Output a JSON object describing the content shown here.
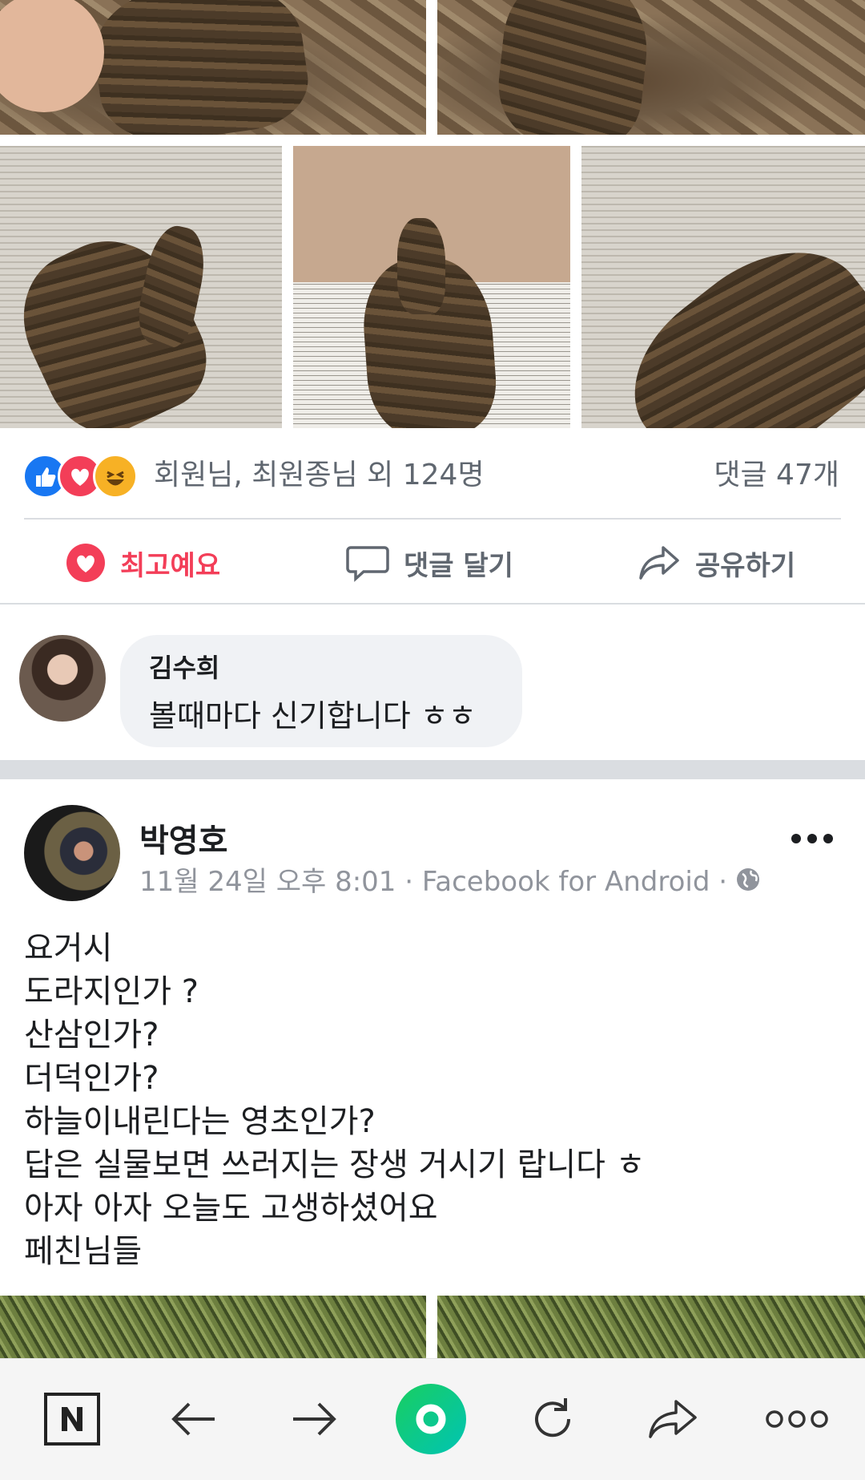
{
  "reactions": {
    "icons": [
      "like-icon",
      "love-icon",
      "haha-icon"
    ],
    "summary": "회원님, 최원종님 외 124명",
    "comments": "댓글 47개"
  },
  "actions": {
    "love": "최고예요",
    "comment": "댓글 달기",
    "share": "공유하기"
  },
  "comment": {
    "author": "김수희",
    "text": "볼때마다 신기합니다 ㅎㅎ"
  },
  "post": {
    "author": "박영호",
    "meta": "11월 24일 오후 8:01 · Facebook for Android ·",
    "lines": [
      "요거시",
      "도라지인가 ?",
      "산삼인가?",
      "더덕인가?",
      "하늘이내린다는 영초인가?",
      "답은 실물보면 쓰러지는 장생 거시기 랍니다 ㅎ",
      "아자 아자 오늘도 고생하셨어요",
      "페친님들"
    ]
  },
  "colors": {
    "facebook_blue": "#1877f2",
    "love_red": "#f33e58",
    "browser_green": "#19ce60"
  },
  "browser_nav": [
    "naver-n-icon",
    "back-arrow-icon",
    "forward-arrow-icon",
    "naver-green-dot-icon",
    "reload-icon",
    "share-icon",
    "more-icon"
  ]
}
